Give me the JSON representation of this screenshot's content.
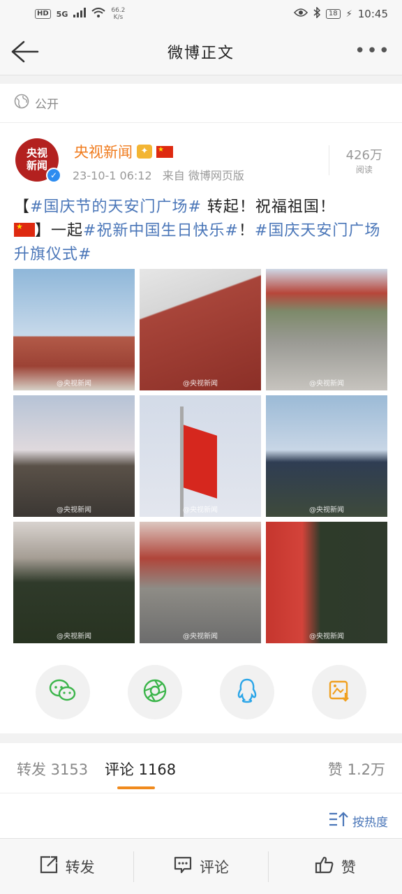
{
  "status_bar": {
    "hd": "HD",
    "network": "5G",
    "speed": "66.2",
    "speed_unit": "K/s",
    "battery": "18",
    "time": "10:45"
  },
  "title_bar": {
    "title": "微博正文",
    "more": "•••"
  },
  "privacy": {
    "label": "公开"
  },
  "post": {
    "author": "央视新闻",
    "avatar_line1": "央视",
    "avatar_line2": "新闻",
    "timestamp": "23-10-1 06:12",
    "source": "来自 微博网页版",
    "read_count": "426万",
    "read_label": "阅读",
    "text": {
      "open_bracket": "【",
      "tag1": "#国庆节的天安门广场#",
      "part1": " 转起！祝福祖国！",
      "close": "】一起",
      "tag2": "#祝新中国生日快乐#",
      "part2": "！",
      "tag3": "#国庆天安门广场升旗仪式#"
    },
    "images": [
      {
        "watermark": "@央视新闻"
      },
      {
        "watermark": "@央视新闻"
      },
      {
        "watermark": "@央视新闻"
      },
      {
        "watermark": "@央视新闻"
      },
      {
        "watermark": "@央视新闻"
      },
      {
        "watermark": "@央视新闻"
      },
      {
        "watermark": "@央视新闻"
      },
      {
        "watermark": "@央视新闻"
      },
      {
        "watermark": "@央视新闻"
      }
    ]
  },
  "share": {
    "icons": [
      "wechat-icon",
      "moments-icon",
      "qq-icon",
      "save-image-icon"
    ],
    "colors": {
      "wechat": "#3bb54a",
      "moments": "#3bb54a",
      "qq": "#2aa5e8",
      "save": "#f0a020"
    }
  },
  "tabs": {
    "repost": "转发 3153",
    "comment": "评论 1168",
    "like": "赞 1.2万"
  },
  "sort": {
    "label": "按热度"
  },
  "bottom_bar": {
    "repost": "转发",
    "comment": "评论",
    "like": "赞"
  },
  "colors": {
    "accent": "#f08a1d",
    "topic_link": "#4a76b8",
    "author_name": "#f07b1d"
  }
}
